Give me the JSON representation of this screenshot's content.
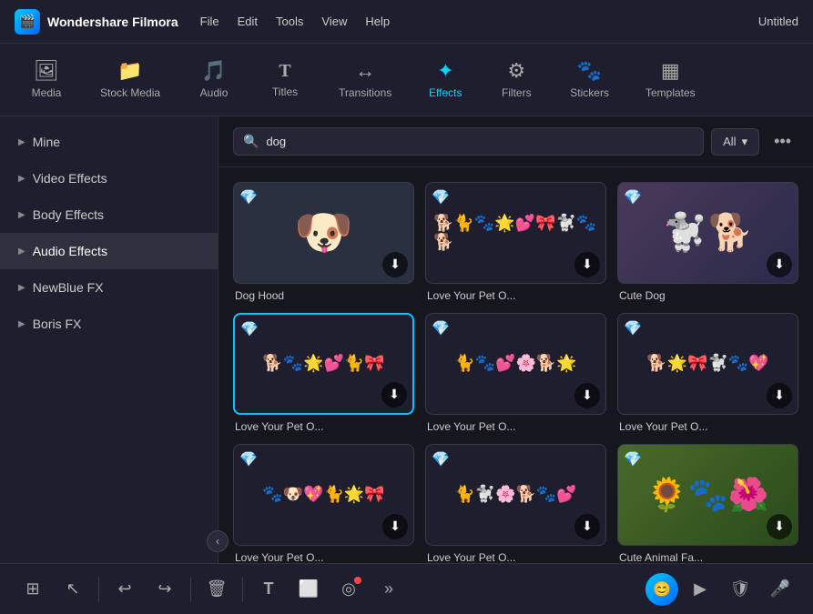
{
  "app": {
    "name": "Wondershare Filmora",
    "logo_char": "🎬",
    "window_title": "Untitled"
  },
  "menu": {
    "items": [
      "File",
      "Edit",
      "Tools",
      "View",
      "Help"
    ]
  },
  "nav_tabs": [
    {
      "id": "media",
      "label": "Media",
      "icon": "🖼"
    },
    {
      "id": "stock-media",
      "label": "Stock Media",
      "icon": "📁"
    },
    {
      "id": "audio",
      "label": "Audio",
      "icon": "🎵"
    },
    {
      "id": "titles",
      "label": "Titles",
      "icon": "T"
    },
    {
      "id": "transitions",
      "label": "Transitions",
      "icon": "↔"
    },
    {
      "id": "effects",
      "label": "Effects",
      "icon": "✨",
      "active": true
    },
    {
      "id": "filters",
      "label": "Filters",
      "icon": "⚙"
    },
    {
      "id": "stickers",
      "label": "Stickers",
      "icon": "🐾"
    },
    {
      "id": "templates",
      "label": "Templates",
      "icon": "▦"
    }
  ],
  "sidebar": {
    "items": [
      {
        "id": "mine",
        "label": "Mine"
      },
      {
        "id": "video-effects",
        "label": "Video Effects"
      },
      {
        "id": "body-effects",
        "label": "Body Effects"
      },
      {
        "id": "audio-effects",
        "label": "Audio Effects",
        "active": true
      },
      {
        "id": "newblue-fx",
        "label": "NewBlue FX"
      },
      {
        "id": "boris-fx",
        "label": "Boris FX"
      }
    ],
    "collapse_label": "‹"
  },
  "search": {
    "placeholder": "dog",
    "filter_label": "All",
    "more_label": "•••"
  },
  "effects": [
    {
      "id": "dog-hood",
      "label": "Dog Hood",
      "type": "dog",
      "color": "#2a3040",
      "emoji": "🐶",
      "premium": true,
      "highlighted": false
    },
    {
      "id": "love-pet-1",
      "label": "Love Your Pet O...",
      "type": "pets",
      "color": "#1e1e2e",
      "emoji": "🐕🐈🐾",
      "premium": true,
      "highlighted": false
    },
    {
      "id": "cute-dog",
      "label": "Cute Dog",
      "type": "cute-dog",
      "color": "#3a2a4a",
      "emoji": "🐩",
      "premium": true,
      "highlighted": false
    },
    {
      "id": "love-pet-2",
      "label": "Love Your Pet O...",
      "type": "pets",
      "color": "#1e1e2e",
      "emoji": "🐕🐾🌟",
      "premium": true,
      "highlighted": true
    },
    {
      "id": "love-pet-3",
      "label": "Love Your Pet O...",
      "type": "pets",
      "color": "#1e1e2e",
      "emoji": "🐈🐾💕",
      "premium": true,
      "highlighted": false
    },
    {
      "id": "love-pet-4",
      "label": "Love Your Pet O...",
      "type": "pets",
      "color": "#1e1e2e",
      "emoji": "🐕🌟🎀",
      "premium": true,
      "highlighted": false
    },
    {
      "id": "love-pet-5",
      "label": "Love Your Pet O...",
      "type": "pets",
      "color": "#1e1e2e",
      "emoji": "🐾🐶💖",
      "premium": true,
      "highlighted": false
    },
    {
      "id": "love-pet-6",
      "label": "Love Your Pet O...",
      "type": "pets",
      "color": "#1e1e2e",
      "emoji": "🐈🐩🌸",
      "premium": true,
      "highlighted": false
    },
    {
      "id": "cute-animal-fa",
      "label": "Cute Animal Fa...",
      "type": "flower",
      "color": "#3a5a2a",
      "emoji": "🌻🐾",
      "premium": true,
      "highlighted": false
    }
  ],
  "toolbar": {
    "buttons": [
      {
        "id": "grid-view",
        "icon": "⊞",
        "label": "grid-view"
      },
      {
        "id": "select",
        "icon": "↖",
        "label": "select-tool"
      },
      {
        "id": "undo",
        "icon": "↩",
        "label": "undo"
      },
      {
        "id": "redo",
        "icon": "↪",
        "label": "redo"
      },
      {
        "id": "delete",
        "icon": "🗑",
        "label": "delete"
      },
      {
        "id": "text",
        "icon": "T",
        "label": "text-tool"
      },
      {
        "id": "crop",
        "icon": "⬜",
        "label": "crop-tool"
      },
      {
        "id": "sticker",
        "icon": "◎",
        "label": "sticker-tool",
        "has_dot": true
      },
      {
        "id": "more",
        "icon": "»",
        "label": "more-tools"
      }
    ],
    "right_buttons": [
      {
        "id": "avatar",
        "icon": "😊",
        "label": "user-avatar"
      },
      {
        "id": "play",
        "icon": "▶",
        "label": "play-button"
      },
      {
        "id": "shield",
        "icon": "🛡",
        "label": "shield"
      },
      {
        "id": "mic",
        "icon": "🎤",
        "label": "microphone"
      }
    ]
  }
}
